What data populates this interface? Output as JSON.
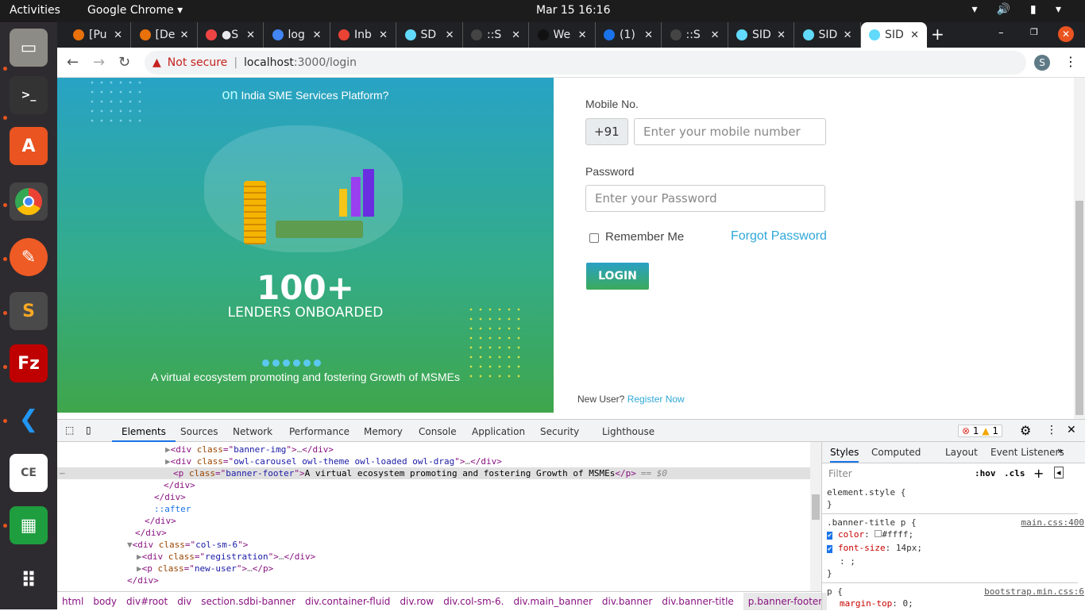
{
  "os": {
    "activities": "Activities",
    "app": "Google Chrome ▾",
    "clock": "Mar 15  16:16"
  },
  "tabs": [
    {
      "label": "[Pu",
      "color": "#e8710a"
    },
    {
      "label": "[De",
      "color": "#e8710a"
    },
    {
      "label": "●S",
      "color": "#e44"
    },
    {
      "label": "log",
      "color": "#4285f4"
    },
    {
      "label": "Inb",
      "color": "#ea4335"
    },
    {
      "label": "SD",
      "color": "#61dafb"
    },
    {
      "label": "::S",
      "color": "#444"
    },
    {
      "label": "We",
      "color": "#111"
    },
    {
      "label": "(1)",
      "color": "#1a73e8"
    },
    {
      "label": "::S",
      "color": "#444"
    },
    {
      "label": "SID",
      "color": "#61dafb"
    },
    {
      "label": "SID",
      "color": "#61dafb"
    },
    {
      "label": "SID",
      "color": "#61dafb"
    }
  ],
  "toolbar": {
    "security": "Not secure",
    "url_host": "localhost",
    "url_path": ":3000/login",
    "avatar": "S"
  },
  "banner": {
    "subtitle_prefix": "on",
    "subtitle": "India SME Services Platform?",
    "count": "100+",
    "count_label": "LENDERS ONBOARDED",
    "footer": "A virtual ecosystem promoting and fostering Growth of MSMEs"
  },
  "form": {
    "mobile_label": "Mobile No.",
    "country_code": "+91",
    "mobile_placeholder": "Enter your mobile number",
    "password_label": "Password",
    "password_placeholder": "Enter your Password",
    "remember": "Remember Me",
    "forgot": "Forgot Password",
    "login": "LOGIN",
    "new_user": "New User?",
    "register": "Register Now"
  },
  "devtools": {
    "tabs": [
      "Elements",
      "Sources",
      "Network",
      "Performance",
      "Memory",
      "Console",
      "Application",
      "Security",
      "Lighthouse"
    ],
    "errors": "1",
    "warnings": "1",
    "side_tabs": [
      "Styles",
      "Computed",
      "Layout",
      "Event Listeners"
    ],
    "filter_placeholder": "Filter",
    "hov": ":hov",
    "cls": ".cls",
    "rules": {
      "element": "element.style {",
      "close": "}",
      "r1_sel": ".banner-title p {",
      "r1_src": "main.css:400",
      "r1_p1": "color",
      "r1_v1": "#ffff;",
      "r1_p2": "font-size",
      "r1_v2": "14px;",
      "r2_sel": "p {",
      "r2_src": "bootstrap.min.css:6",
      "r2_p1": "margin-top",
      "r2_v1": "0;"
    },
    "lines": [
      {
        "tag": "div",
        "cls": "banner-img"
      },
      {
        "tag": "div",
        "cls": "owl-carousel owl-theme owl-loaded owl-drag"
      },
      {
        "tag": "p",
        "cls": "banner-footer",
        "text": "A virtual ecosystem promoting and fostering Growth of MSMEs",
        "suffix": "== $0"
      },
      {
        "close": "</div>"
      },
      {
        "close": "</div>"
      },
      {
        "pseudo": "::after"
      },
      {
        "close": "</div>"
      },
      {
        "close": "</div>"
      },
      {
        "tag": "div",
        "cls": "col-sm-6"
      },
      {
        "tag": "div",
        "cls": "registration"
      },
      {
        "tag": "p",
        "cls": "new-user"
      },
      {
        "close": "</div>"
      }
    ],
    "crumbs": [
      "html",
      "body",
      "div#root",
      "div",
      "section.sdbi-banner",
      "div.container-fluid",
      "div.row",
      "div.col-sm-6.",
      "div.main_banner",
      "div.banner",
      "div.banner-title",
      "p.banner-footer"
    ]
  }
}
